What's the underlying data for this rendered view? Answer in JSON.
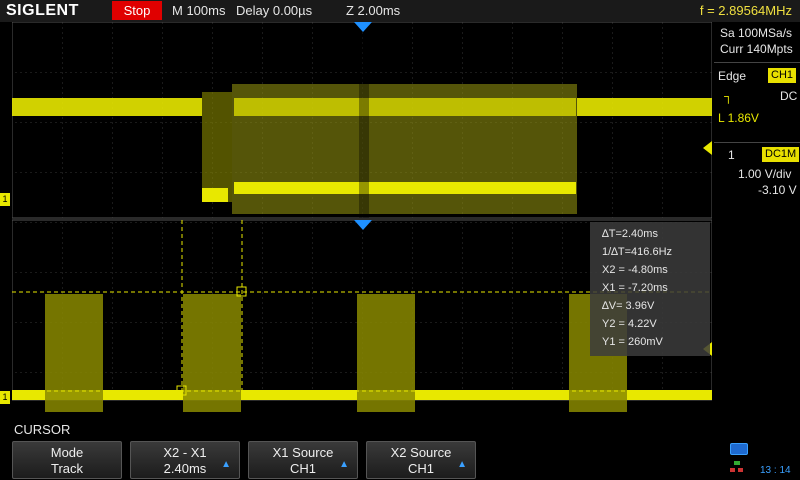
{
  "top_bar": {
    "logo": "SIGLENT",
    "run_state": "Stop",
    "timebase": "M 100ms",
    "delay": "Delay 0.00µs",
    "zoom": "Z 2.00ms",
    "frequency": "f = 2.89564MHz"
  },
  "side_panel": {
    "sample_rate": "Sa 100MSa/s",
    "memory": "Curr 140Mpts",
    "trigger_type": "Edge",
    "trigger_source": "CH1",
    "trigger_coupling": "DC",
    "trigger_level": "L  1.86V",
    "channel_number": "1",
    "channel_coupling": "DC1M",
    "volts_per_div": "1.00 V/div",
    "offset": "-3.10 V"
  },
  "cursor_readout": {
    "delta_t": "∆T=2.40ms",
    "inv_delta_t": "1/∆T=416.6Hz",
    "x2": "X2 = -4.80ms",
    "x1": "X1 = -7.20ms",
    "delta_v": "∆V= 3.96V",
    "y2": "Y2 = 4.22V",
    "y1": "Y1 = 260mV"
  },
  "menu": {
    "title": "CURSOR",
    "softkeys": [
      {
        "label": "Mode",
        "value": "Track"
      },
      {
        "label": "X2 - X1",
        "value": "2.40ms"
      },
      {
        "label": "X1 Source",
        "value": "CH1"
      },
      {
        "label": "X2 Source",
        "value": "CH1"
      }
    ]
  },
  "status": {
    "time": "13 : 14"
  },
  "colors": {
    "trace": "#e8e800",
    "run_stop": "#e00000",
    "marker": "#1e90ff"
  }
}
